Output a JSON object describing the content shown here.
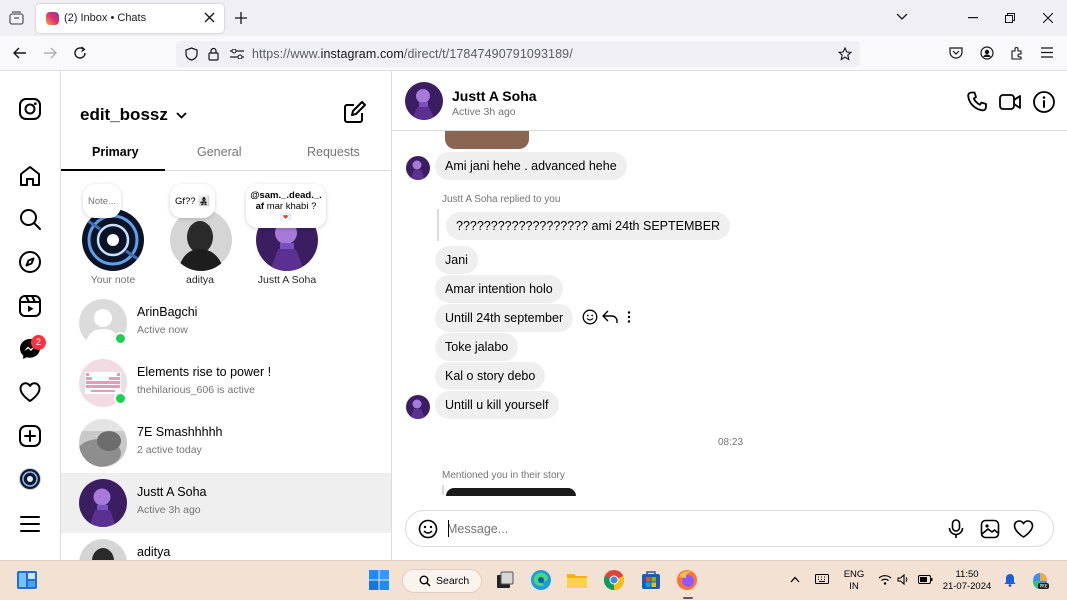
{
  "browser": {
    "tab_title": "(2) Inbox • Chats",
    "url_prefix": "https://www.",
    "url_domain": "instagram.com",
    "url_path": "/direct/t/17847490791093189/"
  },
  "nav": {
    "messages_badge": "2"
  },
  "inbox": {
    "username": "edit_bossz",
    "tabs": [
      "Primary",
      "General",
      "Requests"
    ],
    "notes": [
      {
        "bubble": "Note...",
        "label": "Your note"
      },
      {
        "bubble": "Gf?? 👩‍👧‍👦",
        "label": "aditya"
      },
      {
        "bubble_line1": "@sam._.dead._.",
        "bubble_line2_bold": "af",
        "bubble_line2": " mar khabi ?",
        "label": "Justt A Soha"
      }
    ],
    "conversations": [
      {
        "name": "ArinBagchi",
        "sub": "Active now"
      },
      {
        "name": "Elements rise to power !",
        "sub": "thehilarious_606 is active"
      },
      {
        "name": "7E Smashhhhh",
        "sub": "2 active today"
      },
      {
        "name": "Justt A Soha",
        "sub": "Active 3h ago"
      },
      {
        "name": "aditya",
        "sub": ""
      }
    ]
  },
  "chat": {
    "name": "Justt A Soha",
    "status": "Active 3h ago",
    "messages": [
      "Ami jani hehe . advanced hehe",
      "??????????????????? ami 24th SEPTEMBER",
      "Jani",
      "Amar intention holo",
      "Untill 24th september",
      "Toke jalabo",
      "Kal o story debo",
      "Untill u kill yourself"
    ],
    "reply_note": "Justt A Soha replied to you",
    "timestamp": "08:23",
    "mention_note": "Mentioned you in their story",
    "composer_placeholder": "Message..."
  },
  "taskbar": {
    "search_label": "Search",
    "lang_line1": "ENG",
    "lang_line2": "IN",
    "time": "11:50",
    "date": "21-07-2024"
  },
  "colors": {
    "accent_blue": "#0095f6",
    "online_green": "#1cd14f",
    "badge_red": "#ff3040",
    "avatar_purple": "#5b2b8c"
  }
}
